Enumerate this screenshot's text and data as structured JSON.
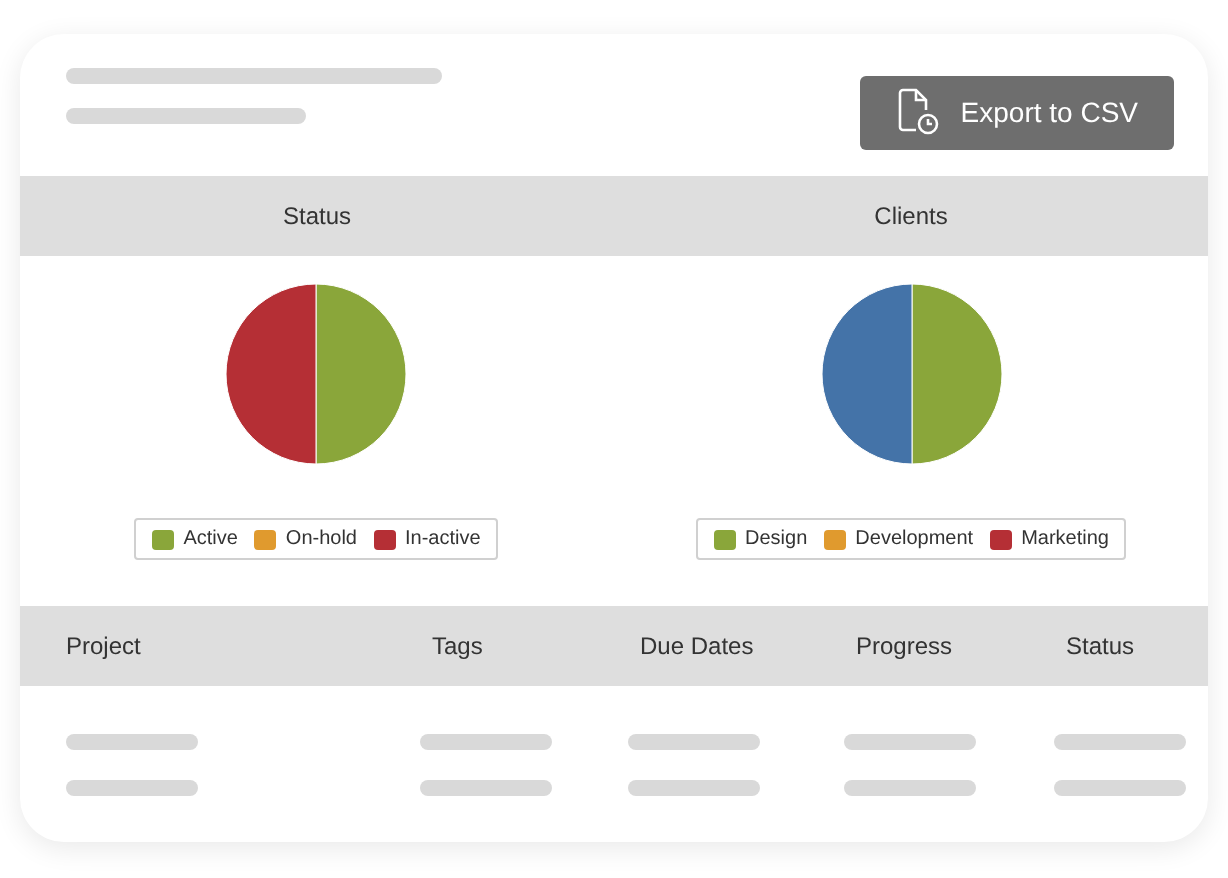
{
  "export_button": {
    "label": "Export to CSV"
  },
  "charts": [
    {
      "chart_data": {
        "type": "pie",
        "title": "Status",
        "values": [
          50,
          0,
          50
        ],
        "colors": [
          "#8aa63a",
          "#e09a2e",
          "#b52f35"
        ]
      },
      "legend": [
        {
          "label": "Active",
          "color": "#8aa63a"
        },
        {
          "label": "On-hold",
          "color": "#e09a2e"
        },
        {
          "label": "In-active",
          "color": "#b52f35"
        }
      ]
    },
    {
      "chart_data": {
        "type": "pie",
        "title": "Clients",
        "values": [
          50,
          0,
          50
        ],
        "colors": [
          "#8aa63a",
          "#e09a2e",
          "#4473a8"
        ]
      },
      "legend": [
        {
          "label": "Design",
          "color": "#8aa63a"
        },
        {
          "label": "Development",
          "color": "#e09a2e"
        },
        {
          "label": "Marketing",
          "color": "#b52f35"
        }
      ]
    }
  ],
  "table": {
    "columns": [
      "Project",
      "Tags",
      "Due Dates",
      "Progress",
      "Status"
    ],
    "rows": [
      {
        "kind": "placeholder"
      },
      {
        "kind": "placeholder"
      }
    ]
  }
}
